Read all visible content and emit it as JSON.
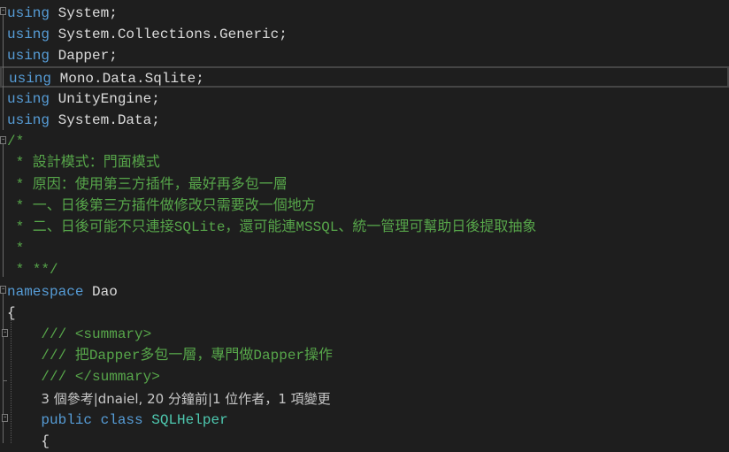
{
  "editor": {
    "lines": [
      {
        "segments": [
          {
            "t": "using",
            "c": "kw"
          },
          {
            "t": " System;"
          }
        ]
      },
      {
        "segments": [
          {
            "t": "using",
            "c": "kw"
          },
          {
            "t": " System.Collections.Generic;"
          }
        ]
      },
      {
        "segments": [
          {
            "t": "using",
            "c": "kw"
          },
          {
            "t": " Dapper;"
          }
        ]
      },
      {
        "segments": [
          {
            "t": "using",
            "c": "kw"
          },
          {
            "t": " Mono.Data.Sqlite;"
          }
        ],
        "current": true
      },
      {
        "segments": [
          {
            "t": "using",
            "c": "kw"
          },
          {
            "t": " UnityEngine;"
          }
        ]
      },
      {
        "segments": [
          {
            "t": "using",
            "c": "kw"
          },
          {
            "t": " System.Data;"
          }
        ]
      },
      {
        "segments": [
          {
            "t": "/*",
            "c": "cm"
          }
        ]
      },
      {
        "segments": [
          {
            "t": " * 設計模式：門面模式",
            "c": "cm"
          }
        ]
      },
      {
        "segments": [
          {
            "t": " * 原因：使用第三方插件，最好再多包一層",
            "c": "cm"
          }
        ]
      },
      {
        "segments": [
          {
            "t": " * 一、日後第三方插件做修改只需要改一個地方",
            "c": "cm"
          }
        ]
      },
      {
        "segments": [
          {
            "t": " * 二、日後可能不只連接SQLite，還可能連MSSQL、統一管理可幫助日後提取抽象",
            "c": "cm"
          }
        ]
      },
      {
        "segments": [
          {
            "t": " *",
            "c": "cm"
          }
        ]
      },
      {
        "segments": [
          {
            "t": " * **/",
            "c": "cm"
          }
        ]
      },
      {
        "segments": [
          {
            "t": "namespace",
            "c": "kw"
          },
          {
            "t": " Dao"
          }
        ]
      },
      {
        "segments": [
          {
            "t": "{"
          }
        ]
      },
      {
        "segments": [
          {
            "t": "    /// <summary>",
            "c": "cm"
          }
        ]
      },
      {
        "segments": [
          {
            "t": "    /// 把Dapper多包一層，專門做Dapper操作",
            "c": "cm"
          }
        ]
      },
      {
        "segments": [
          {
            "t": "    /// </summary>",
            "c": "cm"
          }
        ]
      },
      {
        "segments": [
          {
            "t": "    "
          },
          {
            "t": "3 個參考|dnaiel, 20 分鐘前|1 位作者，1 項變更",
            "c": "lens"
          }
        ]
      },
      {
        "segments": [
          {
            "t": "    "
          },
          {
            "t": "public",
            "c": "kw"
          },
          {
            "t": " "
          },
          {
            "t": "class",
            "c": "kw"
          },
          {
            "t": " "
          },
          {
            "t": "SQLHelper",
            "c": "ty"
          }
        ]
      },
      {
        "segments": [
          {
            "t": "    {"
          }
        ]
      }
    ]
  },
  "colors": {
    "background": "#1e1e1e",
    "keyword": "#569cd6",
    "comment": "#57a64a",
    "type": "#4ec9b0",
    "text": "#dcdcdc"
  }
}
